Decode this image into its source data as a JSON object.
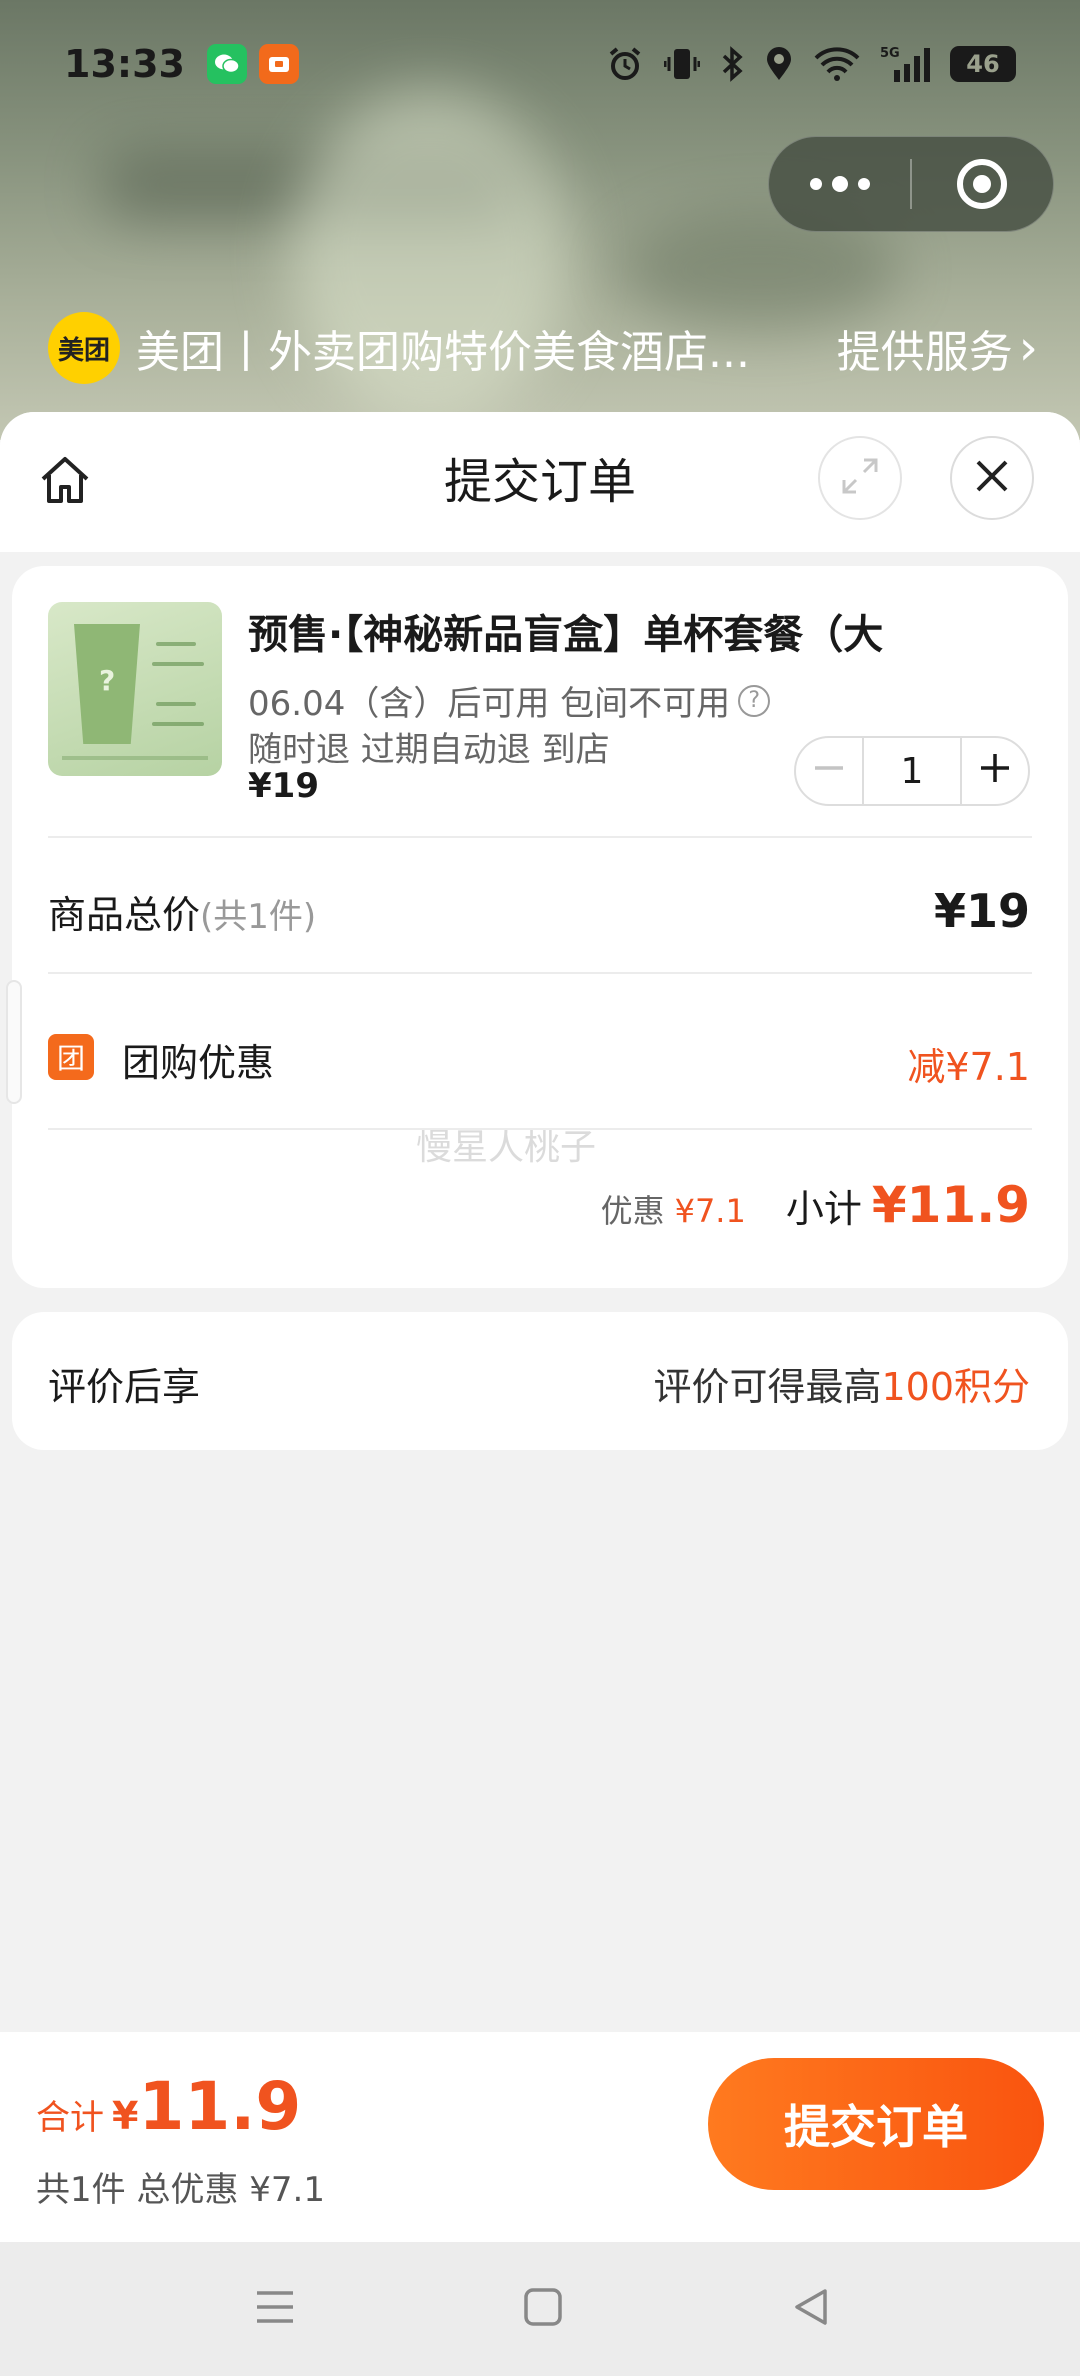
{
  "status_bar": {
    "time": "13:33",
    "network": "5G",
    "battery": "46"
  },
  "mini_program": {
    "logo_text": "美团",
    "name": "美团丨外卖团购特价美食酒店...",
    "service_label": "提供服务"
  },
  "sheet": {
    "title": "提交订单"
  },
  "product": {
    "title": "预售·【神秘新品盲盒】单杯套餐（大",
    "availability": "06.04（含）后可用 包间不可用",
    "tags": "随时退 过期自动退 到店",
    "price": "¥19",
    "quantity": "1"
  },
  "summary": {
    "total_label": "商品总价",
    "total_count": "(共1件)",
    "total_value": "¥19",
    "discount_badge": "团",
    "discount_label": "团购优惠",
    "discount_value": "减¥7.1",
    "watermark": "慢星人桃子",
    "saved_label": "优惠",
    "saved_value": "¥7.1",
    "subtotal_label": "小计",
    "subtotal_value": "¥11.9"
  },
  "review": {
    "label": "评价后享",
    "prefix": "评价可得最高",
    "highlight": "100积分"
  },
  "bottom": {
    "sum_label": "合计",
    "sum_yen": "¥",
    "sum_value": "11.9",
    "sum_detail": "共1件 总优惠 ¥7.1",
    "submit_label": "提交订单"
  },
  "colors": {
    "accent": "#f0531f",
    "button_gradient_start": "#ff7a1f",
    "button_gradient_end": "#f9540f",
    "meituan_yellow": "#ffd000"
  },
  "icons": [
    "home-icon",
    "expand-icon",
    "close-icon",
    "help-icon",
    "minus-icon",
    "plus-icon",
    "menu-icon",
    "square-icon",
    "back-icon"
  ]
}
